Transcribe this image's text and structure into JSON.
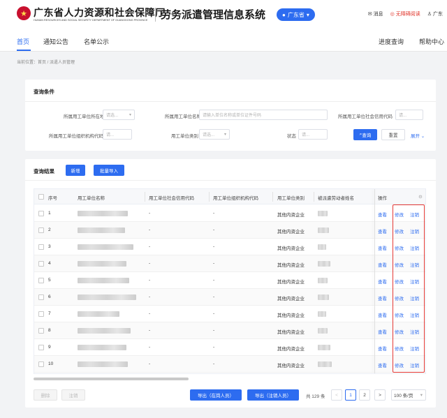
{
  "header": {
    "org_name": "广东省人力资源和社会保障厅",
    "org_name_en": "HUMAN RESOURCES AND SOCIAL SECURITY DEPARTMENT OF GUANGDONG PROVINCE",
    "system_name": "劳务派遣管理信息系统",
    "region": "广东省",
    "tools": {
      "message": "消息",
      "accessible": "无障碍阅读",
      "user": "广东"
    }
  },
  "nav": {
    "items": [
      "首页",
      "通知公告",
      "名单公示"
    ],
    "right": [
      "进度查询",
      "帮助中心"
    ]
  },
  "breadcrumb": "当前位置：首页 / 派遣人员管理",
  "query": {
    "title": "查询条件",
    "fields": {
      "area": {
        "label": "所属用工单位所在地区",
        "placeholder": "请选..."
      },
      "unit_name": {
        "label": "所属用工单位名称",
        "placeholder": "请输入单位名称或单位证件号码"
      },
      "credit_code": {
        "label": "所属用工单位社会信用代码",
        "placeholder": "请..."
      },
      "org_code": {
        "label": "所属用工单位组织机构代码",
        "placeholder": "请..."
      },
      "unit_type": {
        "label": "用工单位类别",
        "placeholder": "请选..."
      },
      "status": {
        "label": "状态",
        "placeholder": "请..."
      }
    },
    "search_label": "查询",
    "reset_label": "重置",
    "expand_label": "展开"
  },
  "results": {
    "title": "查询结果",
    "add_label": "新增",
    "batch_import_label": "批量导入",
    "columns": [
      "序号",
      "用工单位名称",
      "用工单位社会信用代码",
      "用工单位组织机构代码",
      "用工单位类别",
      "被派遣劳动者姓名",
      "操作"
    ],
    "rows": [
      {
        "no": "1",
        "credit": "-",
        "org": "-",
        "type": "其他内资企业",
        "ops": [
          "查看",
          "修改",
          "注销"
        ]
      },
      {
        "no": "2",
        "credit": "-",
        "org": "-",
        "type": "其他内资企业",
        "ops": [
          "查看",
          "修改",
          "注销"
        ]
      },
      {
        "no": "3",
        "credit": "-",
        "org": "-",
        "type": "其他内资企业",
        "ops": [
          "查看",
          "修改",
          "注销"
        ]
      },
      {
        "no": "4",
        "credit": "-",
        "org": "-",
        "type": "其他内资企业",
        "ops": [
          "查看",
          "修改",
          "注销"
        ]
      },
      {
        "no": "5",
        "credit": "-",
        "org": "-",
        "type": "其他内资企业",
        "ops": [
          "查看",
          "修改",
          "注销"
        ]
      },
      {
        "no": "6",
        "credit": "-",
        "org": "-",
        "type": "其他内资企业",
        "ops": [
          "查看",
          "修改",
          "注销"
        ]
      },
      {
        "no": "7",
        "credit": "-",
        "org": "-",
        "type": "其他内资企业",
        "ops": [
          "查看",
          "修改",
          "注销"
        ]
      },
      {
        "no": "8",
        "credit": "-",
        "org": "-",
        "type": "其他内资企业",
        "ops": [
          "查看",
          "修改",
          "注销"
        ]
      },
      {
        "no": "9",
        "credit": "-",
        "org": "-",
        "type": "其他内资企业",
        "ops": [
          "查看",
          "修改",
          "注销"
        ]
      },
      {
        "no": "10",
        "credit": "-",
        "org": "-",
        "type": "其他内资企业",
        "ops": [
          "查看",
          "修改",
          "注销"
        ]
      }
    ],
    "footer": {
      "delete_label": "删除",
      "cancel_label": "注销",
      "export_current_label": "导出（在岗人员）",
      "export_left_label": "导出（注销人员）",
      "total": "共 129 条",
      "prev": "<",
      "pages": [
        "1",
        "2"
      ],
      "next": ">",
      "page_size": "100 条/页"
    }
  },
  "colors": {
    "primary": "#2d6cf0",
    "highlight": "#e53935",
    "brand_red": "#c8102e"
  }
}
